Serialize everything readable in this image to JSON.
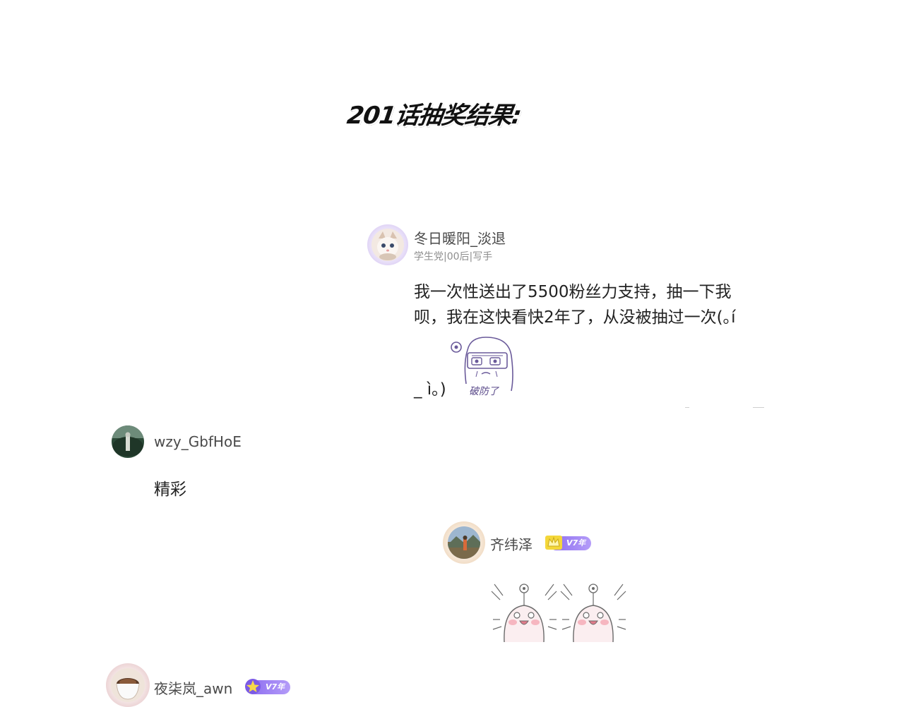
{
  "page": {
    "title": "201话抽奖结果:"
  },
  "comments": [
    {
      "username": "冬日暖阳_淡退",
      "tags": "学生党|00后|写手",
      "text_line1": "我一次性送出了5500粉丝力支持，抽一下我",
      "text_line2": "呗，我在这快看快2年了，从没被抽过一次(｡í",
      "text_line3": "_ ì｡)",
      "sticker_text": "破防了",
      "avatar_icon": "cat-avatar-icon"
    },
    {
      "username": "wzy_GbfHoE",
      "text": "精彩",
      "avatar_icon": "landscape-avatar-icon"
    },
    {
      "username": "齐纬泽",
      "badge": "V7年",
      "avatar_icon": "landscape-avatar-icon",
      "sticker_icon": "excited-blob-sticker-icon"
    },
    {
      "username": "夜柒岚_awn",
      "badge": "V7年",
      "avatar_icon": "coffee-avatar-icon"
    }
  ],
  "colors": {
    "badge_purple": "#8c6cf0",
    "username_gray": "#4a4a4a",
    "tag_gray": "#8e8e8e"
  }
}
